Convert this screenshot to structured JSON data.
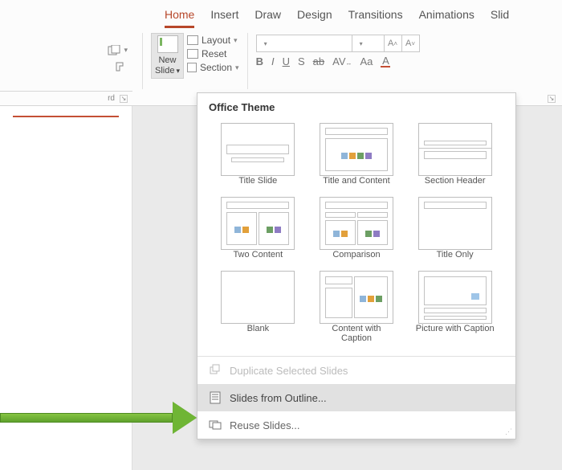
{
  "tabs": [
    "Home",
    "Insert",
    "Draw",
    "Design",
    "Transitions",
    "Animations",
    "Slid"
  ],
  "active_tab_index": 0,
  "clipboard_label_fragment": "rd",
  "slides_group": {
    "new_slide": "New",
    "new_slide2": "Slide",
    "layout": "Layout",
    "reset": "Reset",
    "section": "Section"
  },
  "font_group": {
    "sizebtn_up": "A",
    "sizebtn_down": "A",
    "b": "B",
    "i": "I",
    "u": "U",
    "s": "S",
    "strike": "ab",
    "av": "AV",
    "aa": "Aa"
  },
  "dropdown": {
    "title": "Office Theme",
    "layouts": [
      "Title Slide",
      "Title and Content",
      "Section Header",
      "Two Content",
      "Comparison",
      "Title Only",
      "Blank",
      "Content with Caption",
      "Picture with Caption"
    ],
    "dup": "Duplicate Selected Slides",
    "outline": "Slides from Outline...",
    "reuse": "Reuse Slides..."
  }
}
